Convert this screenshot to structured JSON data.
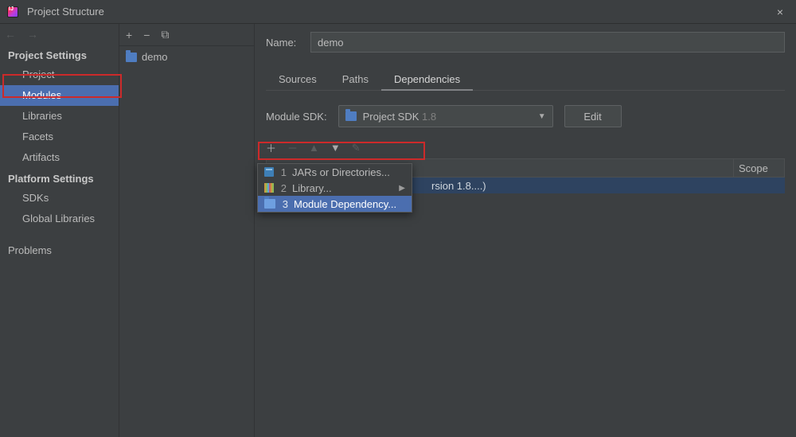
{
  "window": {
    "title": "Project Structure"
  },
  "leftnav": {
    "back_enabled": false,
    "fwd_enabled": false,
    "project_header": "Project Settings",
    "items_project": [
      "Project",
      "Modules",
      "Libraries",
      "Facets",
      "Artifacts"
    ],
    "selected_project_item": "Modules",
    "platform_header": "Platform Settings",
    "items_platform": [
      "SDKs",
      "Global Libraries"
    ],
    "problems": "Problems"
  },
  "modlist": {
    "add": "+",
    "remove": "−",
    "copy": "⧉",
    "items": [
      {
        "name": "demo",
        "icon": "folder-icon"
      }
    ]
  },
  "details": {
    "name_label": "Name:",
    "name_value": "demo",
    "tabs": [
      "Sources",
      "Paths",
      "Dependencies"
    ],
    "active_tab": "Dependencies",
    "sdk_label": "Module SDK:",
    "sdk_value": "Project SDK",
    "sdk_version": "1.8",
    "edit": "Edit",
    "dep_header_export": "",
    "dep_header_scope": "Scope",
    "row_bg_text": "rsion 1.8....)",
    "popup": [
      {
        "n": "1",
        "label": "JARs or Directories...",
        "icon": "jar-icon"
      },
      {
        "n": "2",
        "label": "Library...",
        "icon": "library-icon",
        "has_sub": true
      },
      {
        "n": "3",
        "label": "Module Dependency...",
        "icon": "folder-icon",
        "selected": true
      }
    ]
  }
}
